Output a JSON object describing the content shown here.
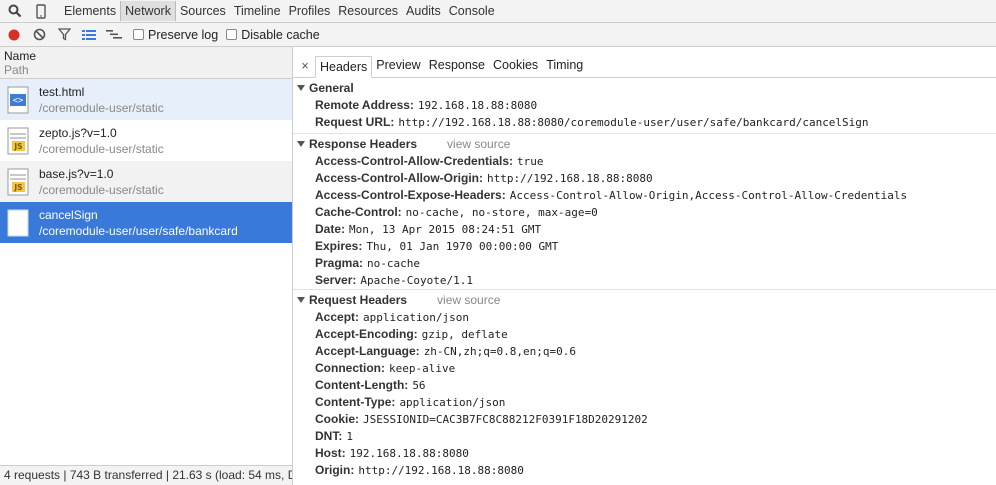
{
  "toolbar": {
    "tabs": [
      "Elements",
      "Network",
      "Sources",
      "Timeline",
      "Profiles",
      "Resources",
      "Audits",
      "Console"
    ],
    "active_tab": "Network"
  },
  "network_toolbar": {
    "preserve_log": "Preserve log",
    "disable_cache": "Disable cache"
  },
  "requests_header": {
    "name": "Name",
    "path": "Path"
  },
  "requests": [
    {
      "name": "test.html",
      "path": "/coremodule-user/static",
      "icon": "html-file-icon"
    },
    {
      "name": "zepto.js?v=1.0",
      "path": "/coremodule-user/static",
      "icon": "js-file-icon"
    },
    {
      "name": "base.js?v=1.0",
      "path": "/coremodule-user/static",
      "icon": "js-file-icon"
    },
    {
      "name": "cancelSign",
      "path": "/coremodule-user/user/safe/bankcard",
      "icon": "blank-file-icon"
    }
  ],
  "status_bar": "4 requests | 743 B transferred | 21.63 s (load: 54 ms, D...",
  "detail_tabs": [
    "Headers",
    "Preview",
    "Response",
    "Cookies",
    "Timing"
  ],
  "close_glyph": "×",
  "general": {
    "title": "General",
    "rows": [
      {
        "k": "Remote Address:",
        "v": "192.168.18.88:8080"
      },
      {
        "k": "Request URL:",
        "v": "http://192.168.18.88:8080/coremodule-user/user/safe/bankcard/cancelSign"
      }
    ]
  },
  "response_headers": {
    "title": "Response Headers",
    "view_source": "view source",
    "rows": [
      {
        "k": "Access-Control-Allow-Credentials:",
        "v": "true"
      },
      {
        "k": "Access-Control-Allow-Origin:",
        "v": "http://192.168.18.88:8080"
      },
      {
        "k": "Access-Control-Expose-Headers:",
        "v": "Access-Control-Allow-Origin,Access-Control-Allow-Credentials"
      },
      {
        "k": "Cache-Control:",
        "v": "no-cache, no-store, max-age=0"
      },
      {
        "k": "Date:",
        "v": "Mon, 13 Apr 2015 08:24:51 GMT"
      },
      {
        "k": "Expires:",
        "v": "Thu, 01 Jan 1970 00:00:00 GMT"
      },
      {
        "k": "Pragma:",
        "v": "no-cache"
      },
      {
        "k": "Server:",
        "v": "Apache-Coyote/1.1"
      }
    ]
  },
  "request_headers": {
    "title": "Request Headers",
    "view_source": "view source",
    "rows": [
      {
        "k": "Accept:",
        "v": "application/json"
      },
      {
        "k": "Accept-Encoding:",
        "v": "gzip, deflate"
      },
      {
        "k": "Accept-Language:",
        "v": "zh-CN,zh;q=0.8,en;q=0.6"
      },
      {
        "k": "Connection:",
        "v": "keep-alive"
      },
      {
        "k": "Content-Length:",
        "v": "56"
      },
      {
        "k": "Content-Type:",
        "v": "application/json"
      },
      {
        "k": "Cookie:",
        "v": "JSESSIONID=CAC3B7FC8C88212F0391F18D20291202"
      },
      {
        "k": "DNT:",
        "v": "1"
      },
      {
        "k": "Host:",
        "v": "192.168.18.88:8080"
      },
      {
        "k": "Origin:",
        "v": "http://192.168.18.88:8080"
      }
    ]
  }
}
